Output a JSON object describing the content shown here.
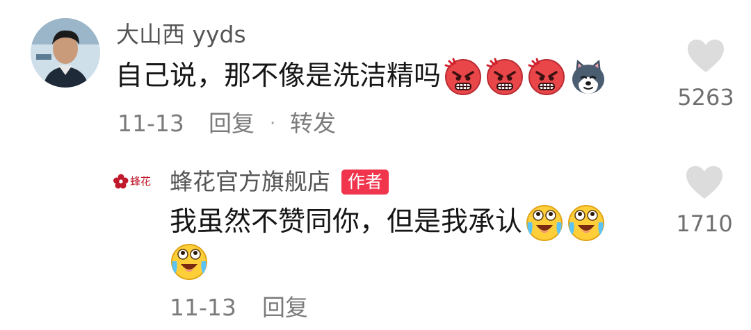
{
  "comment": {
    "username": "大山西 yyds",
    "text": "自己说，那不像是洗洁精吗",
    "emojis": [
      "angry-face-emoji",
      "angry-face-emoji",
      "angry-face-emoji",
      "dog-face-emoji"
    ],
    "date": "11-13",
    "reply_label": "回复",
    "separator": "·",
    "forward_label": "转发",
    "like_count": "5263",
    "avatar_icon": "user-avatar-photo"
  },
  "reply": {
    "logo_text": "蜂花",
    "username": "蜂花官方旗舰店",
    "badge": "作者",
    "text": "我虽然不赞同你，但是我承认",
    "emojis_line1": [
      "laugh-cry-emoji",
      "laugh-cry-emoji"
    ],
    "emojis_line2": [
      "laugh-cry-emoji"
    ],
    "date": "11-13",
    "reply_label": "回复",
    "like_count": "1710"
  },
  "colors": {
    "username": "#555555",
    "meta": "#7b7b7b",
    "heart": "#dddddd",
    "badge_bg": "#f0354d",
    "brand_red": "#c0192b"
  }
}
